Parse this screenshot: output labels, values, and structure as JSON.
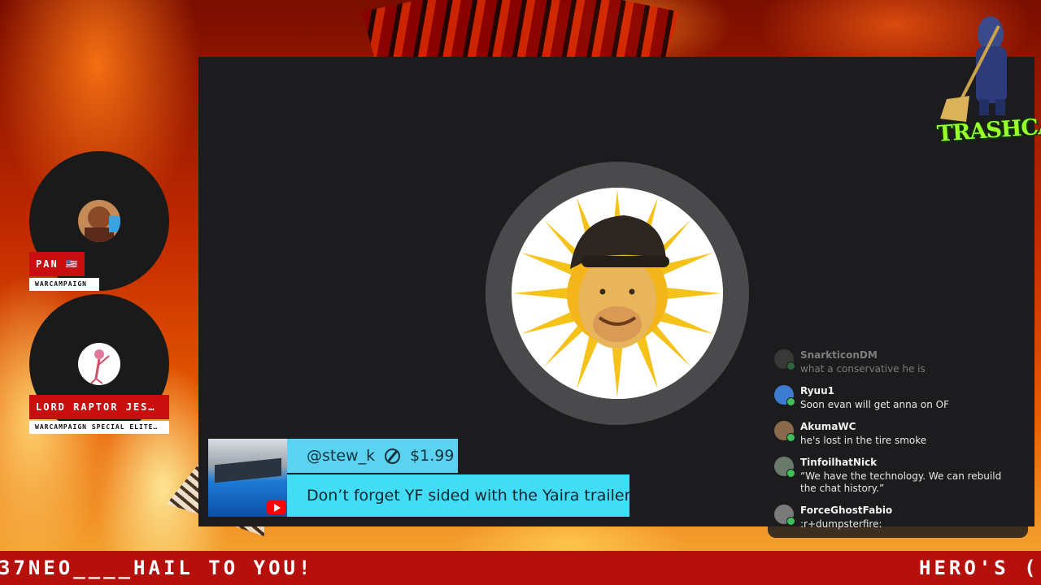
{
  "stream": {
    "logo_text": "TRASHCAST"
  },
  "guests": [
    {
      "name": "PAN 🇺🇸",
      "role": "WARCAMPAIGN"
    },
    {
      "name": "LORD RAPTOR JES…",
      "role": "WARCAMPAIGN SPECIAL ELITE…"
    }
  ],
  "superchat": {
    "user": "@stew_k",
    "amount": "$1.99",
    "message": "Don’t forget YF sided with the Yaira trailer"
  },
  "chat": {
    "messages": [
      {
        "user": "SnarkticonDM",
        "text": "what a conservative he is"
      },
      {
        "user": "Ryuu1",
        "text": "Soon evan will get anna on OF"
      },
      {
        "user": "AkumaWC",
        "text": "he's lost in the tire smoke"
      },
      {
        "user": "TinfoilhatNick",
        "text": "“We have the technology. We can rebuild the chat history.”"
      },
      {
        "user": "ForceGhostFabio",
        "text": ":r+dumpsterfire:"
      }
    ]
  },
  "ticker": {
    "left_text": "37NEO____HAIL TO YOU!",
    "right_text": "HERO'S ("
  },
  "colors": {
    "superchat_header": "#5bd3f0",
    "superchat_body": "#43dcf5",
    "name_tag": "#c80e0e",
    "ticker": "#b5100c",
    "logo": "#9aff2c"
  }
}
